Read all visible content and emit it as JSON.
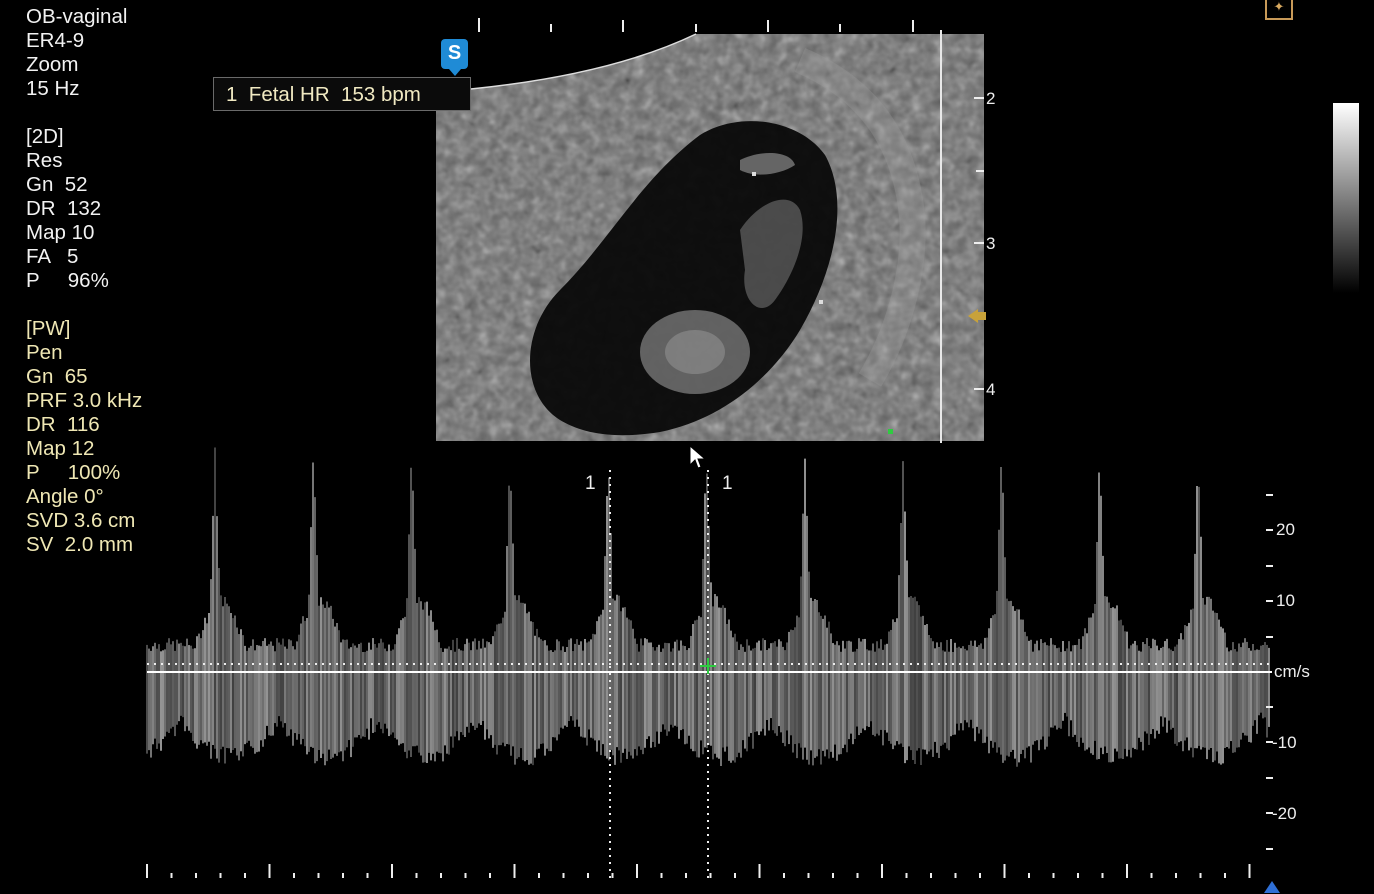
{
  "exam": {
    "preset": "OB-vaginal",
    "probe": "ER4-9",
    "mode": "Zoom",
    "frame_rate": "15 Hz"
  },
  "params_2d": {
    "header": "[2D]",
    "res": "Res",
    "gain": "Gn  52",
    "dr": "DR  132",
    "map": "Map 10",
    "fa": "FA   5",
    "power": "P     96%"
  },
  "params_pw": {
    "header": "[PW]",
    "pen": "Pen",
    "gain": "Gn  65",
    "prf": "PRF 3.0 kHz",
    "dr": "DR  116",
    "map": "Map 12",
    "power": "P     100%",
    "angle": "Angle 0°",
    "svd": "SVD 3.6 cm",
    "sv": "SV  2.0 mm"
  },
  "measurement": {
    "text": "1  Fetal HR  153 bpm"
  },
  "badge": {
    "label": "S"
  },
  "depth_scale": {
    "labels": [
      "2",
      "3",
      "4"
    ]
  },
  "velocity_scale": {
    "unit": "cm/s",
    "labels": [
      "20",
      "10",
      "-10",
      "-20"
    ]
  },
  "calipers": {
    "labels": [
      "1",
      "1"
    ]
  },
  "icons": {
    "probe_orientation": "probe-orientation-icon",
    "cursor": "mouse-pointer-icon",
    "focus": "focus-marker-icon",
    "baseline": "baseline-marker-icon"
  },
  "colors": {
    "text": "#f2f2f2",
    "pw_text": "#efe7b4",
    "badge": "#1f8bd6",
    "caliper_cross": "#2ecc40",
    "focus_marker": "#c8a23a"
  }
}
